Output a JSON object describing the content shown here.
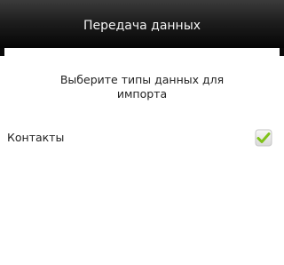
{
  "dialog": {
    "title": "Передача данных",
    "prompt": "Выберите типы данных для импорта"
  },
  "options": [
    {
      "label": "Контакты",
      "checked": true
    }
  ],
  "colors": {
    "titlebar": "#111111",
    "title_text": "#f2f2f2",
    "body_background": "#ffffff",
    "body_text": "#222222",
    "check_green": "#7fc21a"
  },
  "icons": {
    "checkbox": "checkmark-icon"
  }
}
